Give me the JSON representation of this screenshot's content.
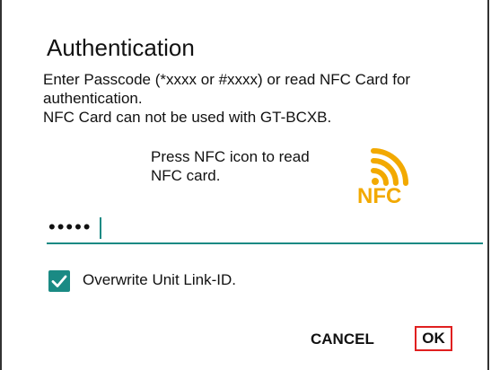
{
  "dialog": {
    "title": "Authentication",
    "message_lines": [
      "Enter Passcode (*xxxx or #xxxx) or read NFC Card for",
      "authentication.",
      "NFC Card can not be used with GT-BCXB."
    ],
    "nfc_hint_lines": [
      "Press NFC icon to read",
      "NFC card."
    ],
    "nfc_icon": {
      "name": "nfc-icon",
      "label": "NFC",
      "color": "#F2A900"
    },
    "passcode": {
      "value": "•••••"
    },
    "overwrite_checkbox": {
      "label": "Overwrite Unit Link-ID.",
      "checked": true
    },
    "buttons": {
      "cancel": "CANCEL",
      "ok": "OK"
    }
  },
  "colors": {
    "accent": "#1a8a84",
    "ok_highlight": "#e02020",
    "nfc": "#F2A900"
  }
}
